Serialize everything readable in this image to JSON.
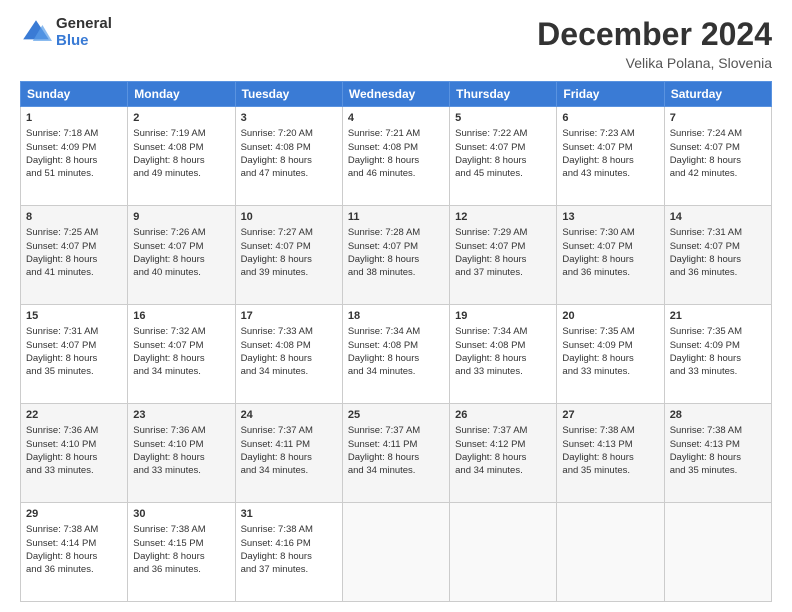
{
  "logo": {
    "general": "General",
    "blue": "Blue"
  },
  "title": "December 2024",
  "subtitle": "Velika Polana, Slovenia",
  "days_header": [
    "Sunday",
    "Monday",
    "Tuesday",
    "Wednesday",
    "Thursday",
    "Friday",
    "Saturday"
  ],
  "weeks": [
    [
      {
        "day": "1",
        "lines": [
          "Sunrise: 7:18 AM",
          "Sunset: 4:09 PM",
          "Daylight: 8 hours",
          "and 51 minutes."
        ]
      },
      {
        "day": "2",
        "lines": [
          "Sunrise: 7:19 AM",
          "Sunset: 4:08 PM",
          "Daylight: 8 hours",
          "and 49 minutes."
        ]
      },
      {
        "day": "3",
        "lines": [
          "Sunrise: 7:20 AM",
          "Sunset: 4:08 PM",
          "Daylight: 8 hours",
          "and 47 minutes."
        ]
      },
      {
        "day": "4",
        "lines": [
          "Sunrise: 7:21 AM",
          "Sunset: 4:08 PM",
          "Daylight: 8 hours",
          "and 46 minutes."
        ]
      },
      {
        "day": "5",
        "lines": [
          "Sunrise: 7:22 AM",
          "Sunset: 4:07 PM",
          "Daylight: 8 hours",
          "and 45 minutes."
        ]
      },
      {
        "day": "6",
        "lines": [
          "Sunrise: 7:23 AM",
          "Sunset: 4:07 PM",
          "Daylight: 8 hours",
          "and 43 minutes."
        ]
      },
      {
        "day": "7",
        "lines": [
          "Sunrise: 7:24 AM",
          "Sunset: 4:07 PM",
          "Daylight: 8 hours",
          "and 42 minutes."
        ]
      }
    ],
    [
      {
        "day": "8",
        "lines": [
          "Sunrise: 7:25 AM",
          "Sunset: 4:07 PM",
          "Daylight: 8 hours",
          "and 41 minutes."
        ]
      },
      {
        "day": "9",
        "lines": [
          "Sunrise: 7:26 AM",
          "Sunset: 4:07 PM",
          "Daylight: 8 hours",
          "and 40 minutes."
        ]
      },
      {
        "day": "10",
        "lines": [
          "Sunrise: 7:27 AM",
          "Sunset: 4:07 PM",
          "Daylight: 8 hours",
          "and 39 minutes."
        ]
      },
      {
        "day": "11",
        "lines": [
          "Sunrise: 7:28 AM",
          "Sunset: 4:07 PM",
          "Daylight: 8 hours",
          "and 38 minutes."
        ]
      },
      {
        "day": "12",
        "lines": [
          "Sunrise: 7:29 AM",
          "Sunset: 4:07 PM",
          "Daylight: 8 hours",
          "and 37 minutes."
        ]
      },
      {
        "day": "13",
        "lines": [
          "Sunrise: 7:30 AM",
          "Sunset: 4:07 PM",
          "Daylight: 8 hours",
          "and 36 minutes."
        ]
      },
      {
        "day": "14",
        "lines": [
          "Sunrise: 7:31 AM",
          "Sunset: 4:07 PM",
          "Daylight: 8 hours",
          "and 36 minutes."
        ]
      }
    ],
    [
      {
        "day": "15",
        "lines": [
          "Sunrise: 7:31 AM",
          "Sunset: 4:07 PM",
          "Daylight: 8 hours",
          "and 35 minutes."
        ]
      },
      {
        "day": "16",
        "lines": [
          "Sunrise: 7:32 AM",
          "Sunset: 4:07 PM",
          "Daylight: 8 hours",
          "and 34 minutes."
        ]
      },
      {
        "day": "17",
        "lines": [
          "Sunrise: 7:33 AM",
          "Sunset: 4:08 PM",
          "Daylight: 8 hours",
          "and 34 minutes."
        ]
      },
      {
        "day": "18",
        "lines": [
          "Sunrise: 7:34 AM",
          "Sunset: 4:08 PM",
          "Daylight: 8 hours",
          "and 34 minutes."
        ]
      },
      {
        "day": "19",
        "lines": [
          "Sunrise: 7:34 AM",
          "Sunset: 4:08 PM",
          "Daylight: 8 hours",
          "and 33 minutes."
        ]
      },
      {
        "day": "20",
        "lines": [
          "Sunrise: 7:35 AM",
          "Sunset: 4:09 PM",
          "Daylight: 8 hours",
          "and 33 minutes."
        ]
      },
      {
        "day": "21",
        "lines": [
          "Sunrise: 7:35 AM",
          "Sunset: 4:09 PM",
          "Daylight: 8 hours",
          "and 33 minutes."
        ]
      }
    ],
    [
      {
        "day": "22",
        "lines": [
          "Sunrise: 7:36 AM",
          "Sunset: 4:10 PM",
          "Daylight: 8 hours",
          "and 33 minutes."
        ]
      },
      {
        "day": "23",
        "lines": [
          "Sunrise: 7:36 AM",
          "Sunset: 4:10 PM",
          "Daylight: 8 hours",
          "and 33 minutes."
        ]
      },
      {
        "day": "24",
        "lines": [
          "Sunrise: 7:37 AM",
          "Sunset: 4:11 PM",
          "Daylight: 8 hours",
          "and 34 minutes."
        ]
      },
      {
        "day": "25",
        "lines": [
          "Sunrise: 7:37 AM",
          "Sunset: 4:11 PM",
          "Daylight: 8 hours",
          "and 34 minutes."
        ]
      },
      {
        "day": "26",
        "lines": [
          "Sunrise: 7:37 AM",
          "Sunset: 4:12 PM",
          "Daylight: 8 hours",
          "and 34 minutes."
        ]
      },
      {
        "day": "27",
        "lines": [
          "Sunrise: 7:38 AM",
          "Sunset: 4:13 PM",
          "Daylight: 8 hours",
          "and 35 minutes."
        ]
      },
      {
        "day": "28",
        "lines": [
          "Sunrise: 7:38 AM",
          "Sunset: 4:13 PM",
          "Daylight: 8 hours",
          "and 35 minutes."
        ]
      }
    ],
    [
      {
        "day": "29",
        "lines": [
          "Sunrise: 7:38 AM",
          "Sunset: 4:14 PM",
          "Daylight: 8 hours",
          "and 36 minutes."
        ]
      },
      {
        "day": "30",
        "lines": [
          "Sunrise: 7:38 AM",
          "Sunset: 4:15 PM",
          "Daylight: 8 hours",
          "and 36 minutes."
        ]
      },
      {
        "day": "31",
        "lines": [
          "Sunrise: 7:38 AM",
          "Sunset: 4:16 PM",
          "Daylight: 8 hours",
          "and 37 minutes."
        ]
      },
      null,
      null,
      null,
      null
    ]
  ]
}
